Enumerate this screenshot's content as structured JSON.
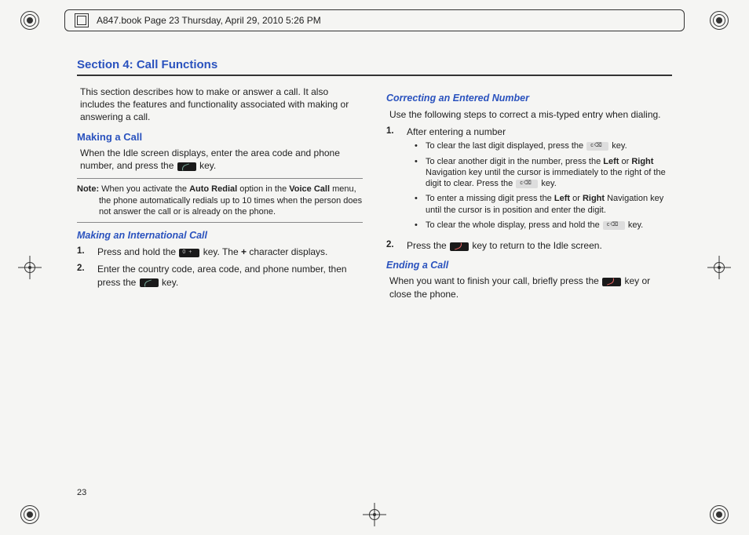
{
  "header": {
    "text": "A847.book  Page 23  Thursday, April 29, 2010  5:26 PM"
  },
  "title": "Section 4: Call Functions",
  "page_number": "23",
  "left": {
    "intro": "This section describes how to make or answer a call. It also includes the features and functionality associated with making or answering a call.",
    "making_heading": "Making a Call",
    "making_text_a": "When the Idle screen displays, enter the area code and phone number, and press the ",
    "making_text_b": " key.",
    "note_prefix": "Note: ",
    "note_a": "When you activate the ",
    "note_b": "Auto Redial",
    "note_c": " option in the ",
    "note_d": "Voice Call",
    "note_e": " menu, the phone automatically redials up to 10 times when the person does not answer the call or is already on the phone.",
    "intl_heading": "Making an International Call",
    "intl_1a": "Press and hold the ",
    "intl_1b": " key. The ",
    "intl_1c": "+",
    "intl_1d": " character displays.",
    "intl_2a": "Enter the country code, area code, and phone number, then press the ",
    "intl_2b": " key.",
    "num1": "1.",
    "num2": "2."
  },
  "right": {
    "correct_heading": "Correcting an Entered Number",
    "correct_intro": "Use the following steps to correct a mis-typed entry when dialing.",
    "num1": "1.",
    "num2": "2.",
    "step1": "After entering a number",
    "b1a": "To clear the last digit displayed, press the ",
    "b1b": " key.",
    "b2a": "To clear another digit in the number, press the ",
    "b2_left": "Left",
    "b2_or": " or ",
    "b2_right": "Right",
    "b2b": " Navigation key until the cursor is immediately to the right of the digit to clear. Press the ",
    "b2c": " key.",
    "b3a": "To enter a missing digit press the ",
    "b3_left": "Left",
    "b3_or": " or ",
    "b3_right": "Right",
    "b3b": " Navigation key until the cursor is in position and enter the digit.",
    "b4a": "To clear the whole display, press and hold the ",
    "b4b": " key.",
    "step2a": "Press the ",
    "step2b": " key to return to the Idle screen.",
    "end_heading": "Ending a Call",
    "end_a": "When you want to finish your call, briefly press the ",
    "end_b": " key or close the phone."
  }
}
